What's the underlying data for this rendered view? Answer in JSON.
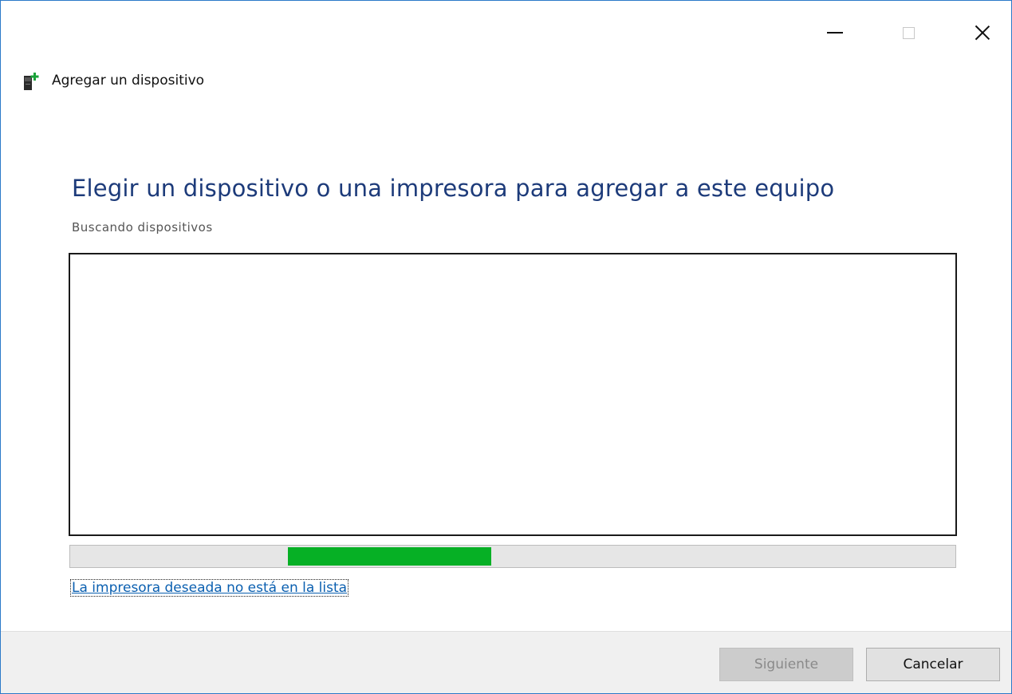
{
  "window": {
    "title": "Agregar un dispositivo",
    "controls": {
      "minimize_icon": "minimize-icon",
      "maximize_icon": "maximize-icon",
      "close_icon": "close-icon"
    }
  },
  "main": {
    "heading": "Elegir un dispositivo o una impresora para agregar a este equipo",
    "status": "Buscando dispositivos",
    "device_list": [],
    "progress_indeterminate": true,
    "link": "La impresora deseada no está en la lista"
  },
  "footer": {
    "next_label": "Siguiente",
    "next_enabled": false,
    "cancel_label": "Cancelar"
  },
  "colors": {
    "heading": "#1d3b7a",
    "progress_fill": "#06b025",
    "link": "#0a5fb0",
    "window_border": "#2b79c9"
  }
}
